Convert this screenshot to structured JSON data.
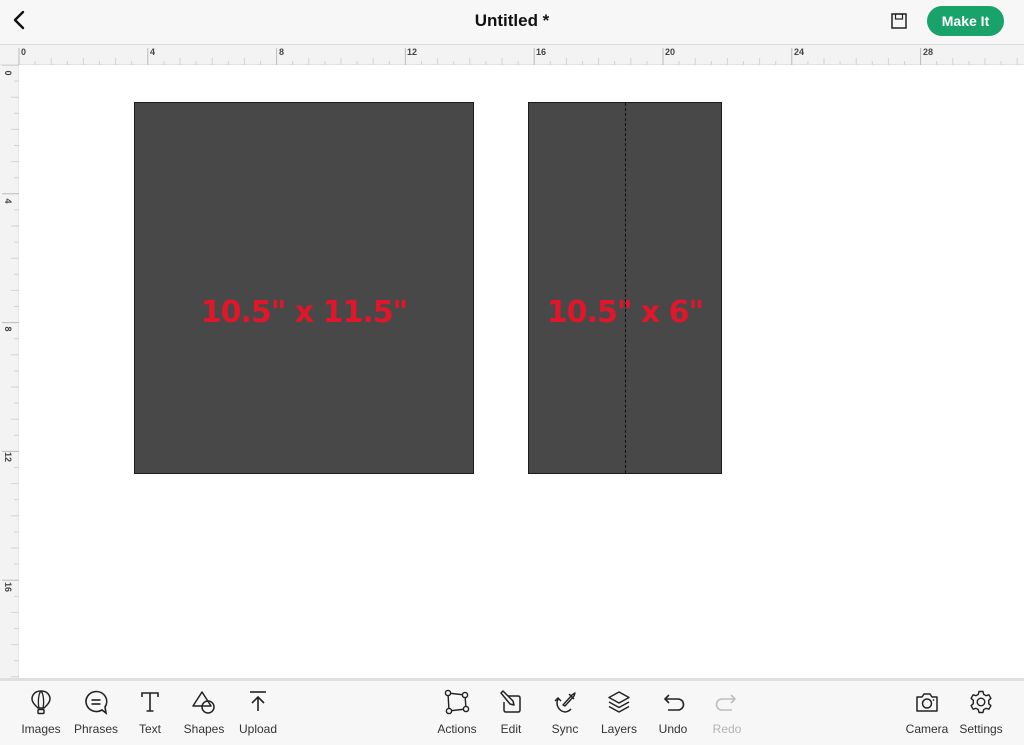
{
  "header": {
    "title": "Untitled *",
    "back_icon": "chevron-left-icon",
    "save_icon": "save-icon",
    "make_it_label": "Make It",
    "accent_color": "#1aa26b"
  },
  "rulers": {
    "horizontal_labels": [
      "0",
      "4",
      "8",
      "12",
      "16",
      "20",
      "24",
      "28"
    ],
    "vertical_labels": [
      "0",
      "4",
      "8",
      "12",
      "16"
    ]
  },
  "canvas": {
    "shapes": [
      {
        "label": "10.5\" x 11.5\"",
        "fill": "#484848",
        "label_color": "#e0162b",
        "has_score_line": false
      },
      {
        "label": "10.5\" x 6\"",
        "fill": "#484848",
        "label_color": "#e0162b",
        "has_score_line": true
      }
    ]
  },
  "toolbar": {
    "left": [
      {
        "label": "Images",
        "icon": "hot-air-balloon-icon"
      },
      {
        "label": "Phrases",
        "icon": "speech-bubble-icon"
      },
      {
        "label": "Text",
        "icon": "text-t-icon"
      },
      {
        "label": "Shapes",
        "icon": "shapes-icon"
      },
      {
        "label": "Upload",
        "icon": "upload-icon"
      }
    ],
    "center": [
      {
        "label": "Actions",
        "icon": "actions-icon"
      },
      {
        "label": "Edit",
        "icon": "edit-icon"
      },
      {
        "label": "Sync",
        "icon": "sync-icon"
      },
      {
        "label": "Layers",
        "icon": "layers-icon"
      },
      {
        "label": "Undo",
        "icon": "undo-icon"
      },
      {
        "label": "Redo",
        "icon": "redo-icon",
        "disabled": true
      }
    ],
    "right": [
      {
        "label": "Camera",
        "icon": "camera-icon"
      },
      {
        "label": "Settings",
        "icon": "gear-icon"
      }
    ]
  }
}
